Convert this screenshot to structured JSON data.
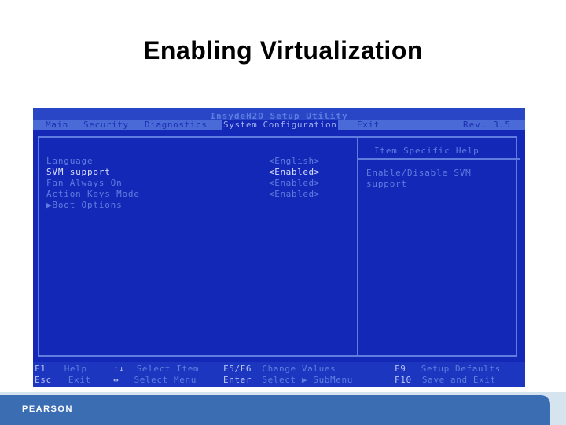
{
  "slide": {
    "title": "Enabling Virtualization"
  },
  "bios": {
    "utility_title": "InsydeH2O Setup Utility",
    "revision": "Rev. 3.5",
    "menu": [
      {
        "label": "Main"
      },
      {
        "label": "Security"
      },
      {
        "label": "Diagnostics"
      },
      {
        "label": "System Configuration",
        "active": true
      },
      {
        "label": "Exit"
      }
    ],
    "items": [
      {
        "label": "Language",
        "value": "<English>"
      },
      {
        "label": "SVM support",
        "value": "<Enabled>",
        "selected": true
      },
      {
        "label": "Fan Always On",
        "value": "<Enabled>"
      },
      {
        "label": "Action Keys Mode",
        "value": "<Enabled>"
      },
      {
        "label": "▶Boot Options",
        "value": ""
      }
    ],
    "help": {
      "title": "Item Specific Help",
      "text": "Enable/Disable SVM support"
    },
    "footer": {
      "f1_key": "F1",
      "f1_desc": "Help",
      "esc_key": "Esc",
      "esc_desc": "Exit",
      "updown_key": "↑↓",
      "updown_desc": "Select Item",
      "leftright_key": "↔",
      "leftright_desc": "Select Menu",
      "f5f6_key": "F5/F6",
      "f5f6_desc": "Change Values",
      "enter_key": "Enter",
      "enter_desc": "Select ▶ SubMenu",
      "f9_key": "F9",
      "f9_desc": "Setup Defaults",
      "f10_key": "F10",
      "f10_desc": "Save and Exit"
    }
  },
  "branding": {
    "logo": "PEARSON"
  }
}
